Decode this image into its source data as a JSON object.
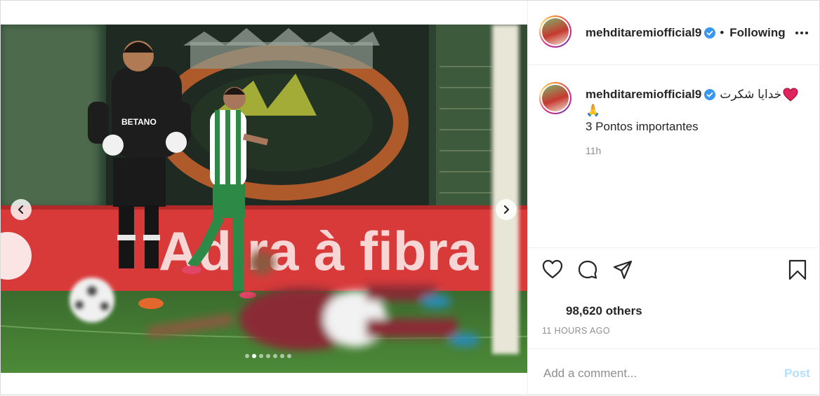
{
  "header": {
    "username": "mehditaremiofficial9",
    "follow_state": "Following",
    "separator": "•",
    "more_label": "•••"
  },
  "caption": {
    "username": "mehditaremiofficial9",
    "arabic_text": "خدایا شکرت",
    "emoji_pray": "🙏",
    "text": "3 Pontos importantes",
    "time_relative": "11h"
  },
  "stats": {
    "likes": "98,620 others",
    "posted": "11 HOURS AGO"
  },
  "comment": {
    "placeholder": "Add a comment...",
    "post_label": "Post"
  },
  "carousel": {
    "total_slides": 7,
    "active_index": 1,
    "banner_text": "Adira à fibra",
    "jersey_sponsor": "BETANO"
  },
  "colors": {
    "verified": "#3897f0",
    "post_button": "#b2dffc",
    "heart": "#e0245e",
    "banner_red": "#d83a3a"
  }
}
